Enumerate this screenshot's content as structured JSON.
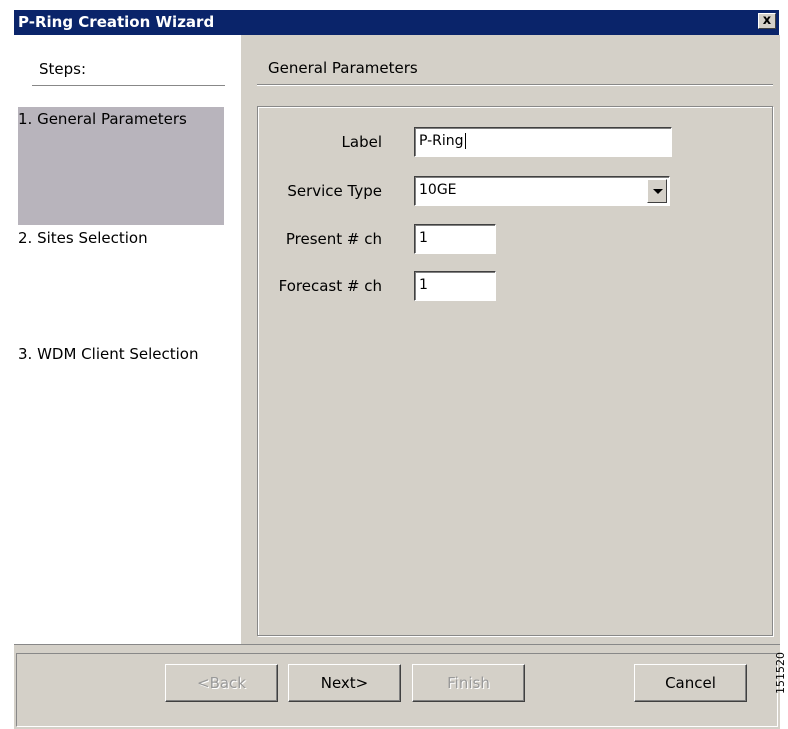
{
  "window": {
    "title": "P-Ring Creation Wizard",
    "close_symbol": "x"
  },
  "steps": {
    "header": "Steps:",
    "items": [
      {
        "label": "1. General Parameters",
        "active": true
      },
      {
        "label": "2. Sites Selection",
        "active": false
      },
      {
        "label": "3. WDM Client Selection",
        "active": false
      }
    ]
  },
  "general": {
    "title": "General Parameters",
    "label_field": {
      "label": "Label",
      "value": "P-Ring"
    },
    "service_type": {
      "label": "Service Type",
      "value": "10GE"
    },
    "present_ch": {
      "label": "Present # ch",
      "value": "1"
    },
    "forecast_ch": {
      "label": "Forecast # ch",
      "value": "1"
    }
  },
  "buttons": {
    "back": "<Back",
    "next": "Next>",
    "finish": "Finish",
    "cancel": "Cancel"
  },
  "figure_code": "151520",
  "colors": {
    "title_bar": "#0a246a",
    "dialog": "#d4d0c8",
    "active_step": "#b8b4bc"
  }
}
